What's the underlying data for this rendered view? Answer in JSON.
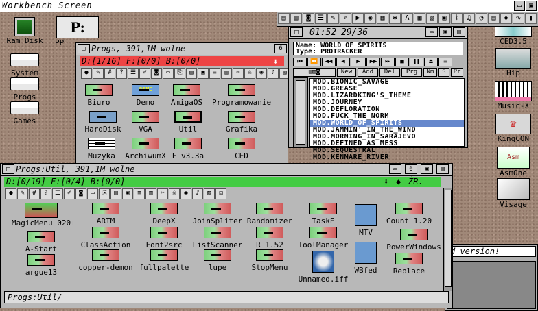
{
  "screen": {
    "title": "Workbench  Screen"
  },
  "desktop_icons": [
    {
      "label": "Ram Disk"
    },
    {
      "label": "System"
    },
    {
      "label": "Progs"
    },
    {
      "label": "Games"
    },
    {
      "label": "PP"
    }
  ],
  "right_icons": [
    {
      "label": "CED3.5"
    },
    {
      "label": "Hip"
    },
    {
      "label": "Music-X"
    },
    {
      "label": "KingCON"
    },
    {
      "label": "AsmOne"
    },
    {
      "label": "Visage"
    }
  ],
  "player": {
    "time": "01:52",
    "track": "29/36",
    "name_label": "Name:",
    "name_value": "World Of Spirits",
    "type_label": "Type:",
    "type_value": "Protracker",
    "buttons": [
      "New",
      "Add",
      "Del",
      "Prg",
      "Nm",
      "S",
      "Pr"
    ],
    "tracks": [
      "MOD.BIONIC_SAVAGE",
      "MOD.GREASE",
      "MOD.LIZARDKING'S_THEME",
      "MOD.JOURNEY",
      "MOD.DEFLORATION",
      "MOD.FUCK_THE_NORM",
      "MOD.WORLD_OF_SPIRITS",
      "MOD.JAMMIN'_IN_THE_WIND",
      "MOD.MORNING_IN_SARAJEVO",
      "MOD.DEFINED_AS_MESS",
      "MOD.SEQUESTRAL",
      "MOD.KENMARE_RIVER"
    ],
    "selected_index": 6
  },
  "progs_window": {
    "title": "Progs,    391,1M  wolne",
    "path": "D:[1/16]  F:[0/0]  B:[0/0]",
    "items": [
      "Biuro",
      "Demo",
      "AmigaOS",
      "Programowanie",
      "HardDisk",
      "VGA",
      "Util",
      "Grafika",
      "Muzyka",
      "ArchiwumX",
      "E_v3.3a",
      "CED"
    ],
    "demo_badge": "DEMO"
  },
  "util_window": {
    "title": "Progs:Util,    391,1M  wolne",
    "path": "D:[0/19]  F:[0/4]  B:[0/0]",
    "path_right": "ŻR.",
    "status": "Progs:Util/",
    "items": [
      "MagicMenu_020+",
      "ARTM",
      "DeepX",
      "JoinSpliter",
      "Randomizer",
      "TaskE",
      "MTV",
      "Count_1.20",
      "A-Start",
      "ClassAction",
      "Font2src",
      "ListScanner",
      "R_1.52",
      "ToolManager",
      "PowerWindows",
      "argue13",
      "copper-demon",
      "fullpalette",
      "lupe",
      "StopMenu",
      "Unnamed.iff",
      "WBfed",
      "Replace"
    ]
  },
  "back_window": {
    "text": "d version!"
  },
  "colors": {
    "accent_red": "#ee4444",
    "accent_green": "#44cc44",
    "selection": "#6688cc"
  }
}
